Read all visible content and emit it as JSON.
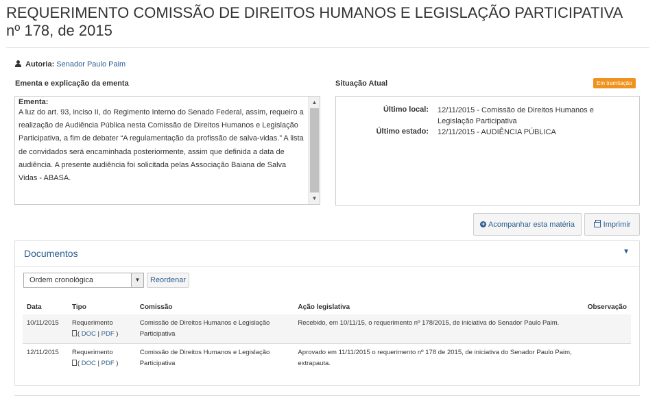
{
  "page": {
    "title_line1": "REQUERIMENTO COMISSÃO DE DIREITOS HUMANOS E LEGISLAÇÃO PARTICIPATIVA",
    "title_line2": "nº 178, de 2015"
  },
  "autoria": {
    "label": "Autoria:",
    "author": "Senador Paulo Paim",
    "icon": "user-icon"
  },
  "ementa": {
    "section_label": "Ementa e explicação da ementa",
    "heading": "Ementa:",
    "text": "A luz do art. 93, inciso II, do Regimento Interno do Senado Federal, assim, requeiro a realização de Audiência Pública nesta Comissão de Direitos Humanos e Legislação Participativa, a fim de debater “A regulamentação da profissão de salva-vidas.” A lista de convidados será encaminhada posteriormente, assim que definida a data de audiência. A presente audiência foi solicitada pelas Associação Baiana de Salva Vidas - ABASA."
  },
  "situacao": {
    "section_label": "Situação Atual",
    "badge": "Em tramitação",
    "badge_color": "#f0921e",
    "ultimo_local_label": "Último local:",
    "ultimo_local_value": "12/11/2015 - Comissão de Direitos Humanos e Legislação Participativa",
    "ultimo_estado_label": "Último estado:",
    "ultimo_estado_value": "12/11/2015 - AUDIÊNCIA PÚBLICA"
  },
  "actions": {
    "acompanhar": "Acompanhar esta matéria",
    "imprimir": "Imprimir"
  },
  "documentos": {
    "title": "Documentos",
    "order_select": "Ordem cronológica",
    "reorder_button": "Reordenar",
    "columns": [
      "Data",
      "Tipo",
      "Comissão",
      "Ação legislativa",
      "Observação"
    ],
    "rows": [
      {
        "data": "10/11/2015",
        "tipo": "Requerimento",
        "doc": "DOC",
        "pdf": "PDF",
        "comissao": "Comissão de Direitos Humanos e Legislação Participativa",
        "acao": "Recebido, em 10/11/15, o requerimento nº 178/2015, de iniciativa do Senador Paulo Paim.",
        "obs": ""
      },
      {
        "data": "12/11/2015",
        "tipo": "Requerimento",
        "doc": "DOC",
        "pdf": "PDF",
        "comissao": "Comissão de Direitos Humanos e Legislação Participativa",
        "acao": "Aprovado em 11/11/2015 o requerimento nº 178 de 2015, de iniciativa do Senador Paulo Paim, extrapauta.",
        "obs": ""
      }
    ]
  },
  "colors": {
    "link": "#2a5d8f",
    "badge": "#f0921e"
  }
}
